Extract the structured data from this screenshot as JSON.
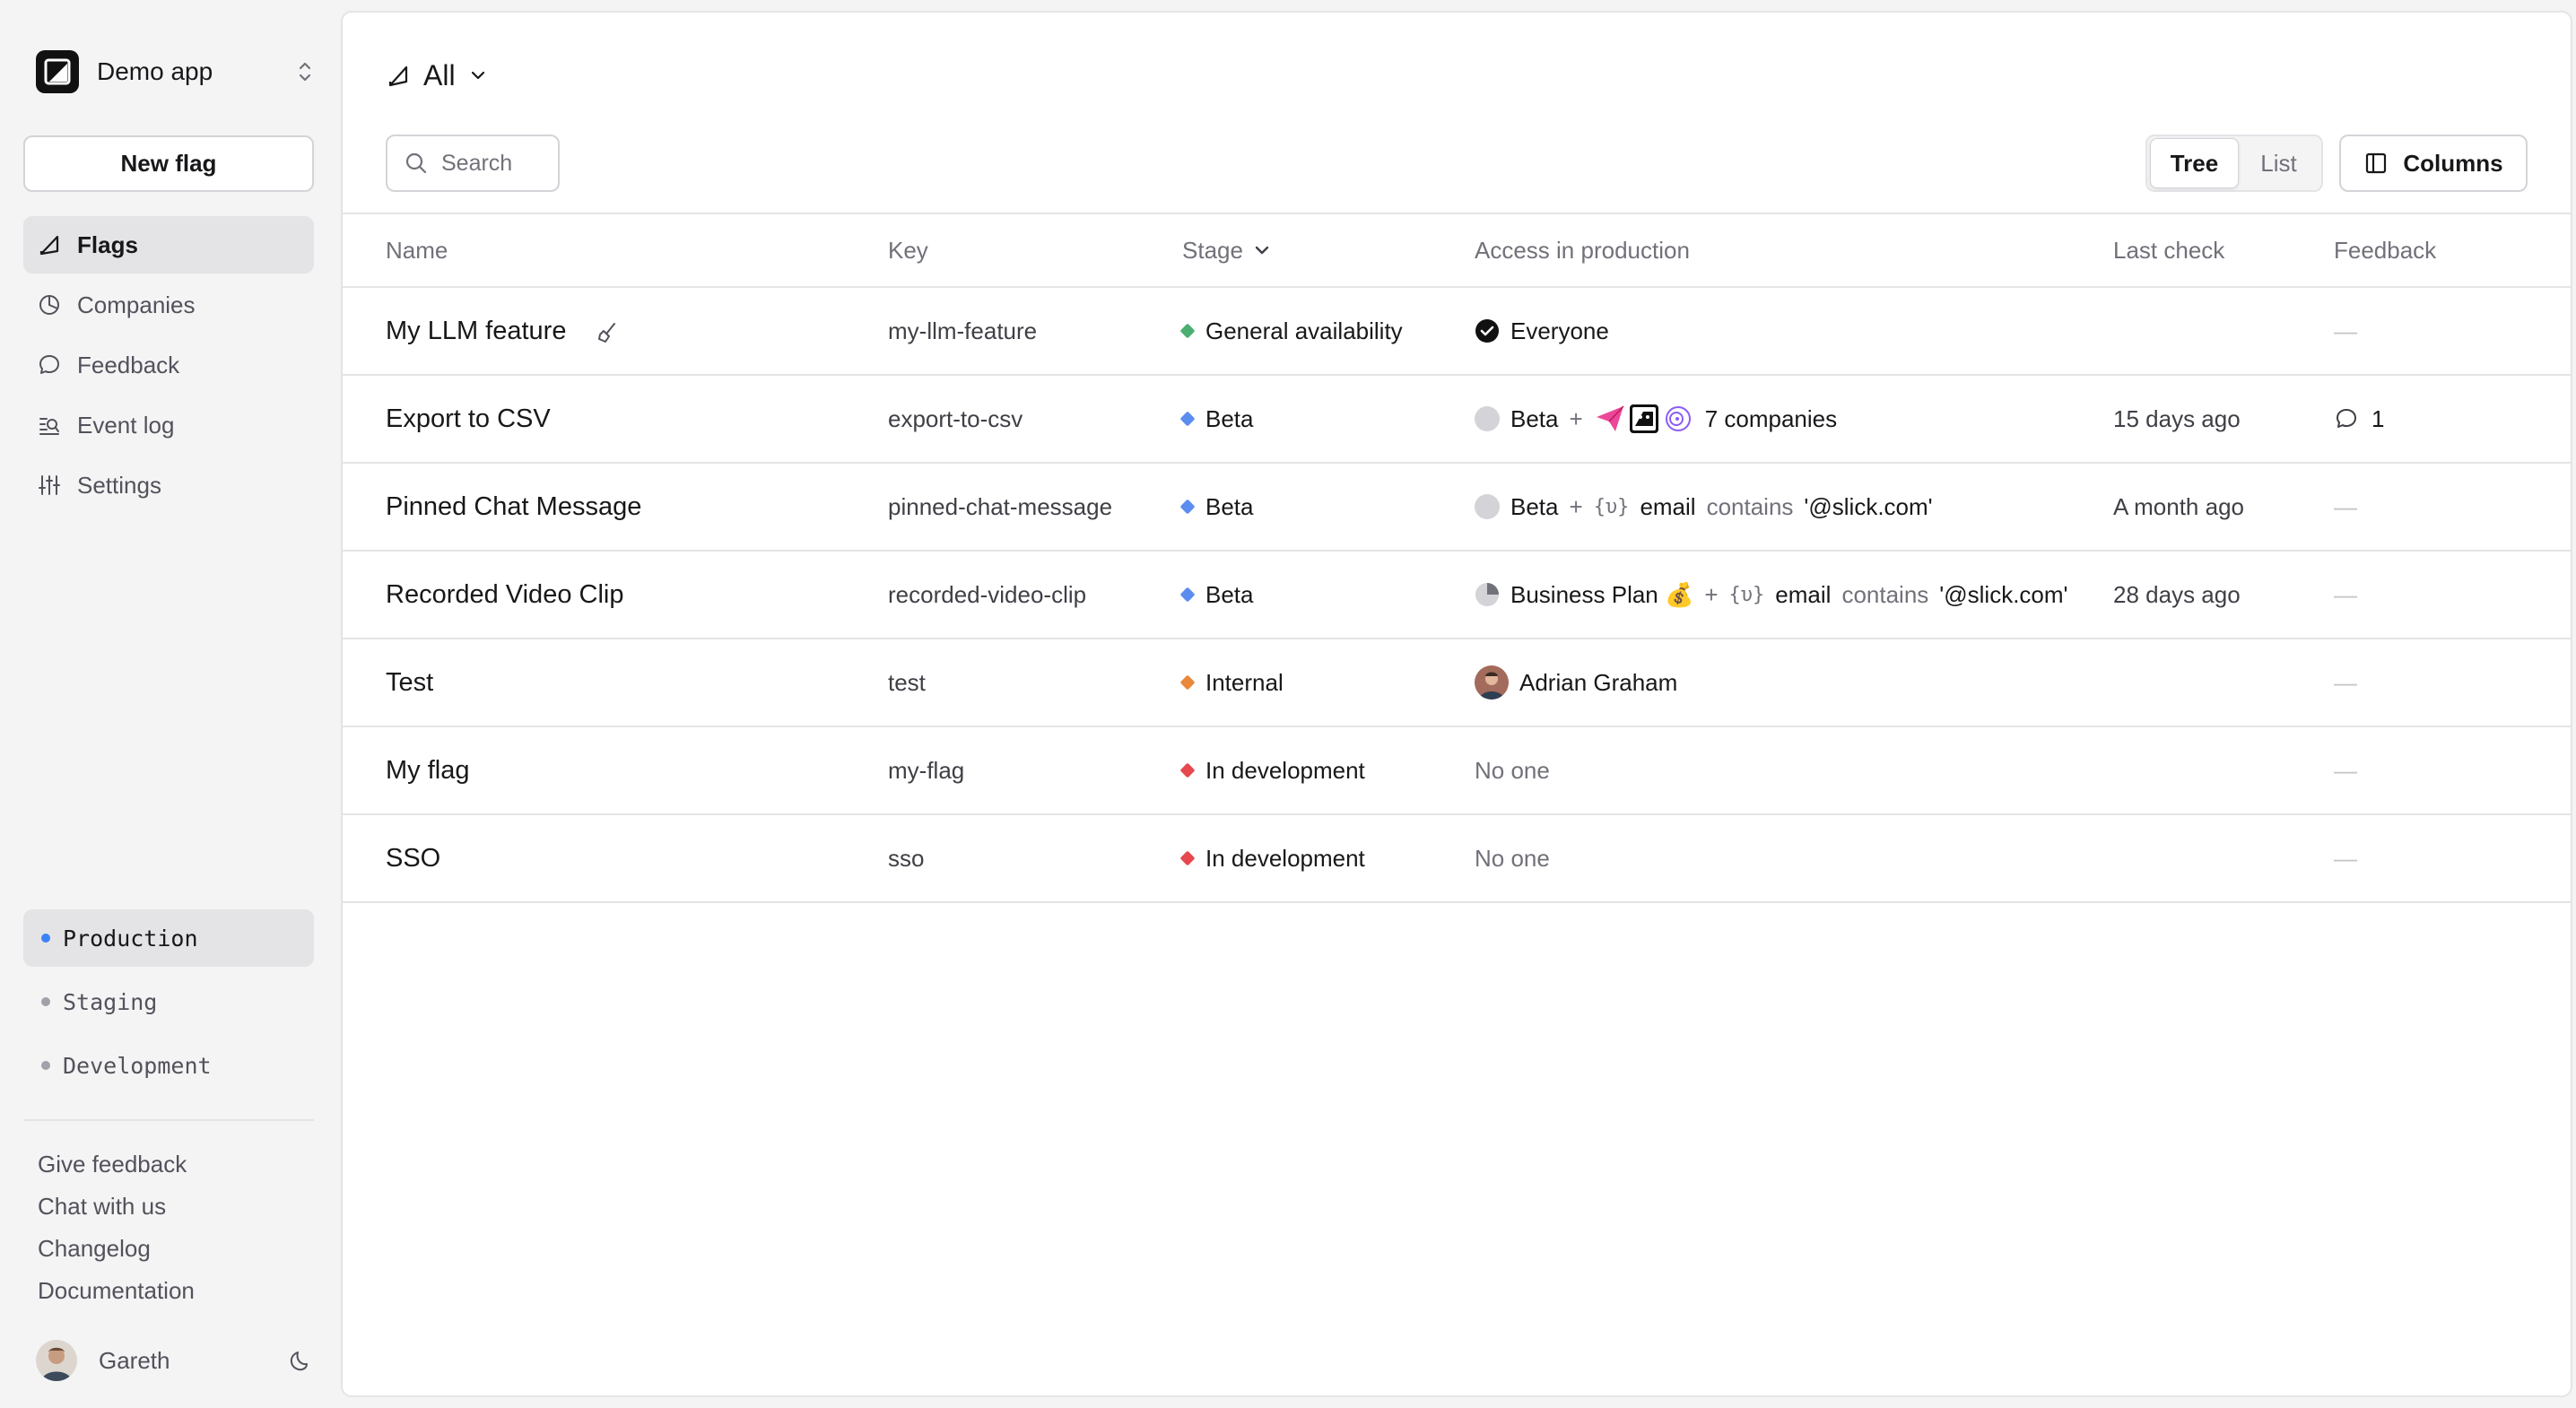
{
  "sidebar": {
    "app_name": "Demo app",
    "new_flag_label": "New flag",
    "nav": [
      {
        "label": "Flags",
        "icon": "flag-icon",
        "active": true
      },
      {
        "label": "Companies",
        "icon": "pie-chart-icon",
        "active": false
      },
      {
        "label": "Feedback",
        "icon": "chat-bubble-icon",
        "active": false
      },
      {
        "label": "Event log",
        "icon": "search-log-icon",
        "active": false
      },
      {
        "label": "Settings",
        "icon": "sliders-icon",
        "active": false
      }
    ],
    "environments": [
      {
        "label": "Production",
        "active": true
      },
      {
        "label": "Staging",
        "active": false
      },
      {
        "label": "Development",
        "active": false
      }
    ],
    "footer_links": [
      "Give feedback",
      "Chat with us",
      "Changelog",
      "Documentation"
    ],
    "user": {
      "name": "Gareth"
    }
  },
  "main": {
    "filter_label": "All",
    "search_placeholder": "Search",
    "view_toggle": {
      "tree": "Tree",
      "list": "List",
      "selected": "Tree"
    },
    "columns_label": "Columns",
    "columns": {
      "name": "Name",
      "key": "Key",
      "stage": "Stage",
      "access": "Access in production",
      "last_check": "Last check",
      "feedback": "Feedback"
    },
    "rows": [
      {
        "name": "My LLM feature",
        "key": "my-llm-feature",
        "stage": "General availability",
        "stage_color": "#4caf72",
        "access": {
          "segment": "Everyone"
        },
        "last_check": "",
        "feedback": "—"
      },
      {
        "name": "Export to CSV",
        "key": "export-to-csv",
        "stage": "Beta",
        "stage_color": "#5b8def",
        "access": {
          "segment": "Beta",
          "plus": "+",
          "companies": "7 companies"
        },
        "last_check": "15 days ago",
        "feedback": "1"
      },
      {
        "name": "Pinned Chat Message",
        "key": "pinned-chat-message",
        "stage": "Beta",
        "stage_color": "#5b8def",
        "access": {
          "segment": "Beta",
          "plus": "+",
          "var": "{υ}",
          "attr": "email",
          "op": "contains",
          "value": "'@slick.com'"
        },
        "last_check": "A month ago",
        "feedback": "—"
      },
      {
        "name": "Recorded Video Clip",
        "key": "recorded-video-clip",
        "stage": "Beta",
        "stage_color": "#5b8def",
        "access": {
          "segment": "Business Plan 💰",
          "plus": "+",
          "var": "{υ}",
          "attr": "email",
          "op": "contains",
          "value": "'@slick.com'"
        },
        "last_check": "28 days ago",
        "feedback": "—"
      },
      {
        "name": "Test",
        "key": "test",
        "stage": "Internal",
        "stage_color": "#e8883a",
        "access": {
          "user": "Adrian Graham"
        },
        "last_check": "",
        "feedback": "—"
      },
      {
        "name": "My flag",
        "key": "my-flag",
        "stage": "In development",
        "stage_color": "#e5484d",
        "access": {
          "none": "No one"
        },
        "last_check": "",
        "feedback": "—"
      },
      {
        "name": "SSO",
        "key": "sso",
        "stage": "In development",
        "stage_color": "#e5484d",
        "access": {
          "none": "No one"
        },
        "last_check": "",
        "feedback": "—"
      }
    ]
  }
}
